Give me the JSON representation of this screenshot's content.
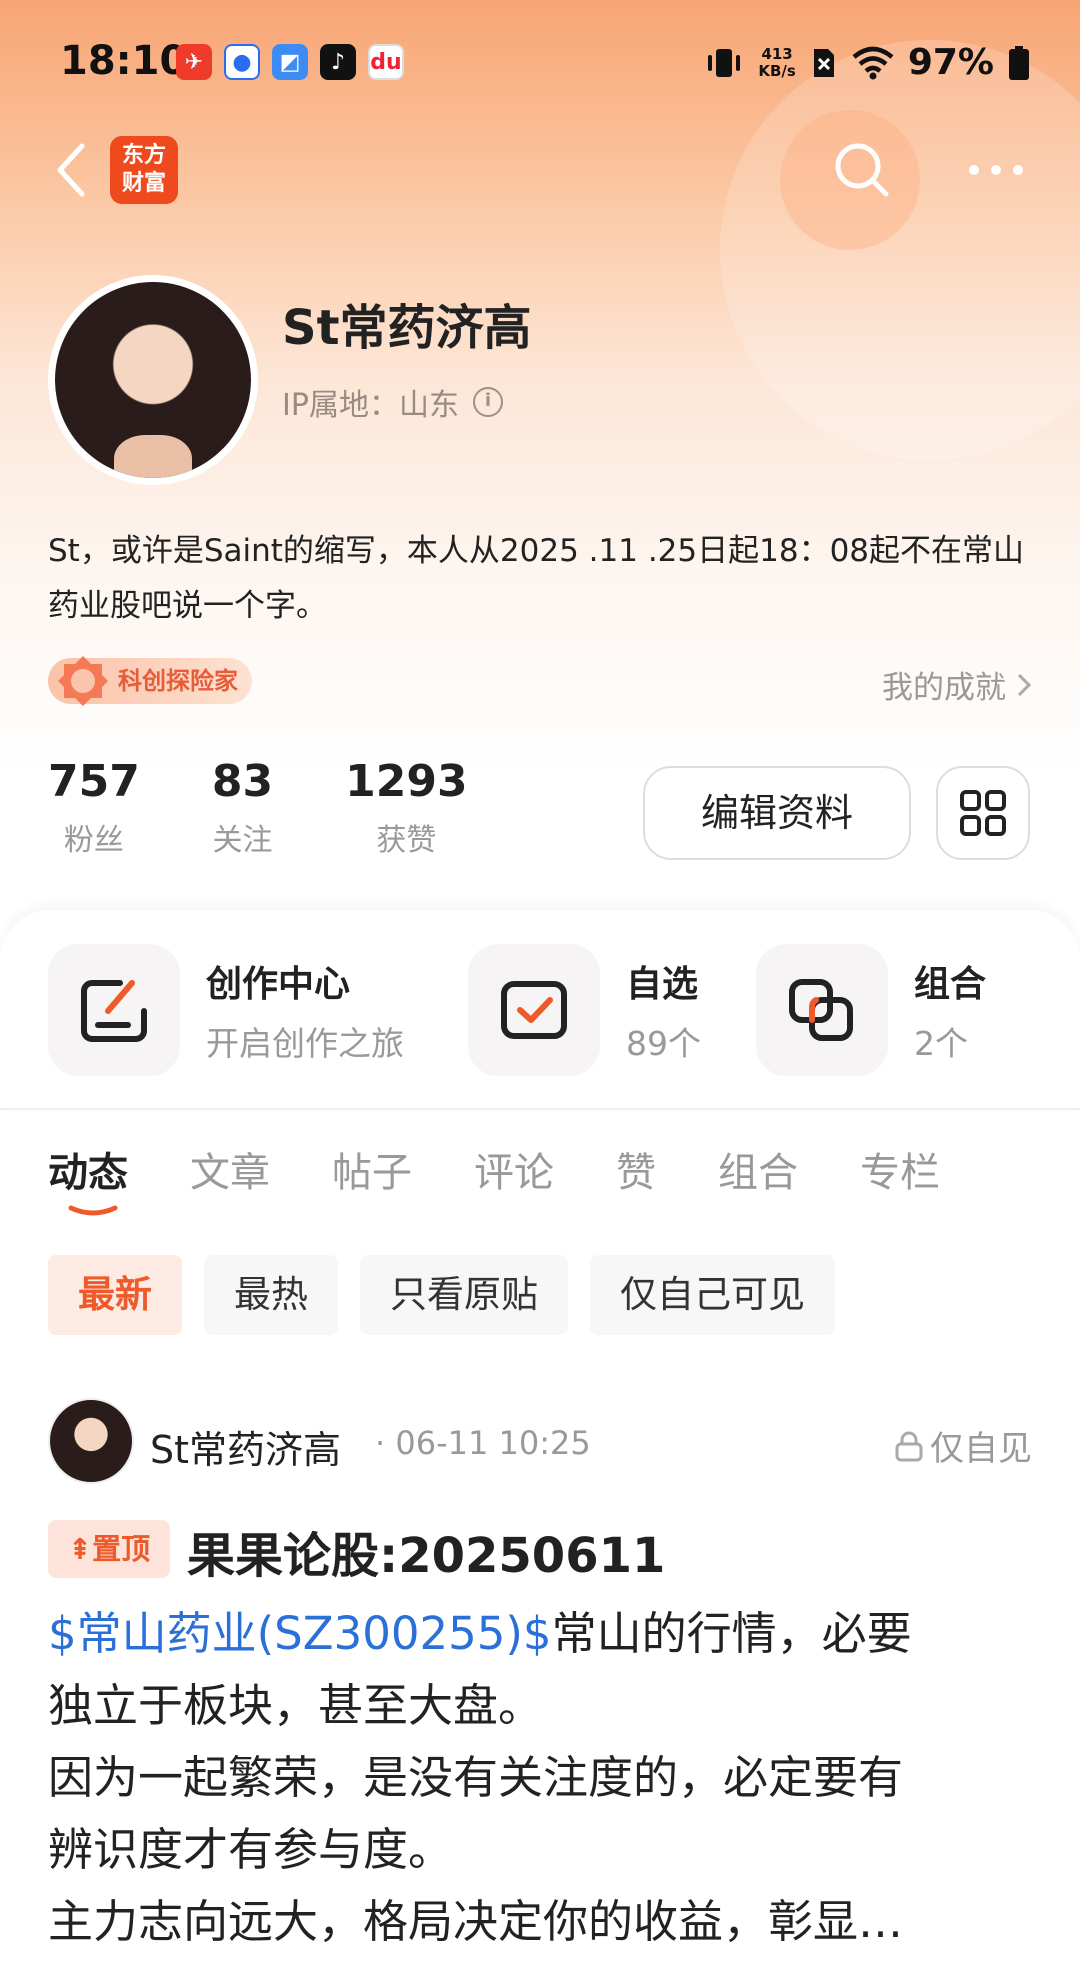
{
  "status_bar": {
    "time": "18:10",
    "net_speed_value": "413",
    "net_speed_unit": "KB/s",
    "battery": "97%",
    "app_icons": [
      "ticket-app-icon",
      "blue-circle-app-icon",
      "blue-square-app-icon",
      "tiktok-icon",
      "dewu-app-icon"
    ]
  },
  "header": {
    "logo_text_line1": "东方",
    "logo_text_line2": "财富"
  },
  "profile": {
    "username": "St常药济高",
    "ip_location": "IP属地：山东",
    "bio": "St，或许是Saint的缩写，本人从2025 .11 .25日起18：08起不在常山药业股吧说一个字。",
    "badge": "科创探险家",
    "achievement_link": "我的成就",
    "stats": [
      {
        "value": "757",
        "label": "粉丝"
      },
      {
        "value": "83",
        "label": "关注"
      },
      {
        "value": "1293",
        "label": "获赞"
      }
    ],
    "edit_button": "编辑资料"
  },
  "cards": [
    {
      "title": "创作中心",
      "sub": "开启创作之旅",
      "icon": "create-pen-icon"
    },
    {
      "title": "自选",
      "sub": "89个",
      "icon": "checkbox-icon"
    },
    {
      "title": "组合",
      "sub": "2个",
      "icon": "portfolio-icon"
    }
  ],
  "tabs": [
    "动态",
    "文章",
    "帖子",
    "评论",
    "赞",
    "组合",
    "专栏"
  ],
  "active_tab": "动态",
  "filters": [
    "最新",
    "最热",
    "只看原贴",
    "仅自己可见"
  ],
  "post": {
    "author": "St常药济高",
    "meta": "· 06-11 10:25",
    "visibility": "仅自见",
    "pin_label": "置顶",
    "title": "果果论股:20250611",
    "stock_link": "$常山药业(SZ300255)$",
    "body_first_line_rest": "常山的行情，必要",
    "body_line2": "独立于板块，甚至大盘。",
    "body_line3": "因为一起繁荣，是没有关注度的，必定要有",
    "body_line4": "辨识度才有参与度。",
    "body_line5": "主力志向远大，格局决定你的收益，彰显…"
  },
  "colors": {
    "accent": "#ef5a2a",
    "link": "#2b6fd8",
    "hero_top": "#f8a574"
  }
}
